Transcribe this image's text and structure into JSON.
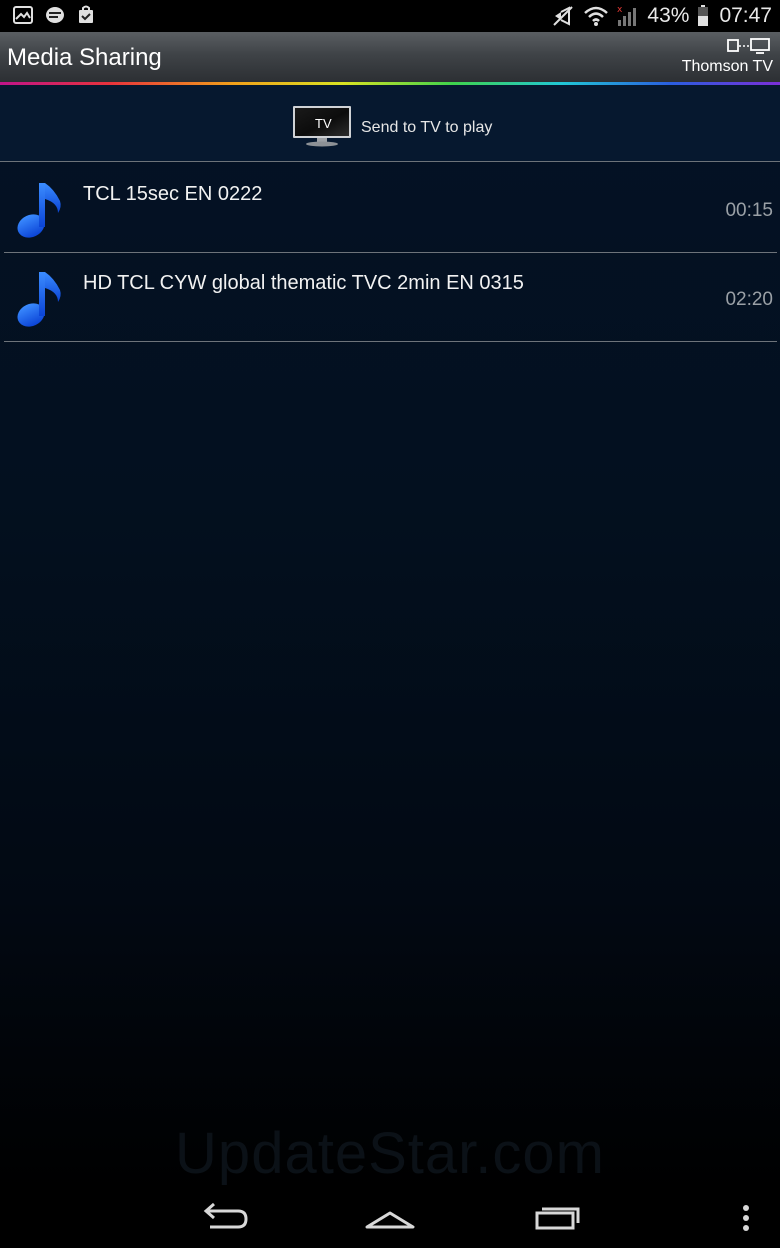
{
  "status_bar": {
    "left_icons": [
      "gallery-icon",
      "messenger-icon",
      "shopping-bag-icon"
    ],
    "right_icons": [
      "mute-icon",
      "wifi-icon",
      "signal-icon",
      "battery-icon"
    ],
    "battery_percent": "43%",
    "time": "07:47"
  },
  "action_bar": {
    "title": "Media Sharing",
    "device_name": "Thomson TV",
    "device_icon": "devices-connected-icon"
  },
  "send_row": {
    "tv_icon_label": "TV",
    "text": "Send to TV to play"
  },
  "media_items": [
    {
      "icon": "music-note-icon",
      "title": "TCL 15sec EN 0222",
      "duration": "00:15"
    },
    {
      "icon": "music-note-icon",
      "title": "HD TCL CYW global thematic TVC 2min EN 0315",
      "duration": "02:20"
    }
  ],
  "watermark": "UpdateStar.com",
  "nav_bar": {
    "buttons": [
      "back-icon",
      "home-icon",
      "recent-apps-icon",
      "overflow-menu-icon"
    ]
  },
  "colors": {
    "accent_blue": "#1f6fff",
    "background": "#041226"
  }
}
